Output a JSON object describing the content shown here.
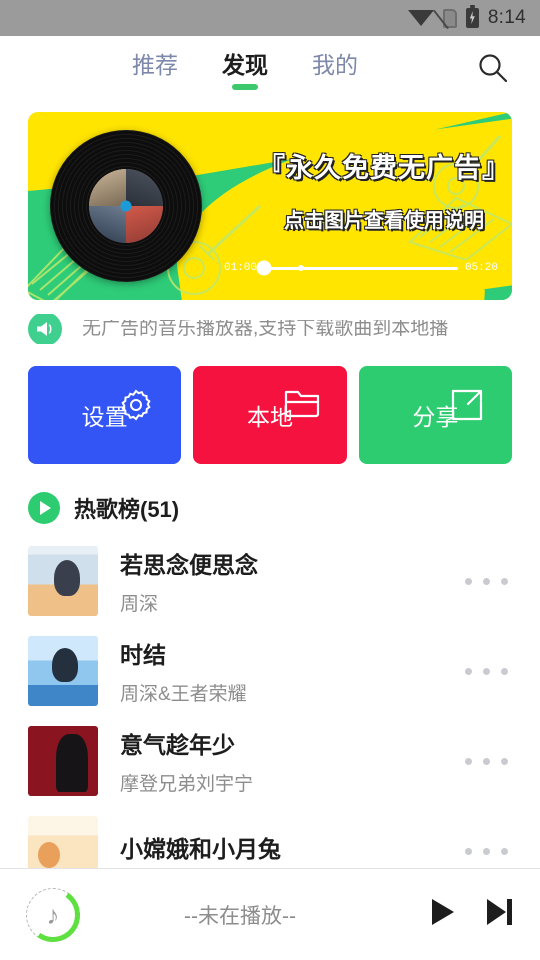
{
  "statusbar": {
    "time": "8:14",
    "icons": [
      "wifi-icon",
      "sim-card-off-icon",
      "battery-charging-icon"
    ]
  },
  "topbar": {
    "tabs": [
      {
        "label": "推荐",
        "active": false
      },
      {
        "label": "发现",
        "active": true
      },
      {
        "label": "我的",
        "active": false
      }
    ],
    "search_icon": "search-icon"
  },
  "banner": {
    "title": "『永久免费无广告』",
    "subtitle": "点击图片查看使用说明",
    "current_time": "01:00",
    "total_time": "05:20",
    "colors": {
      "yellow": "#ffe500",
      "green": "#2ecc78",
      "outline": "#bfe86b"
    }
  },
  "notice": {
    "icon": "megaphone-icon",
    "text": "无广告的音乐播放器,支持下载歌曲到本地播"
  },
  "actions": [
    {
      "label": "设置",
      "icon": "gear-icon",
      "color": "#3355f5"
    },
    {
      "label": "本地",
      "icon": "folder-icon",
      "color": "#f5123e"
    },
    {
      "label": "分享",
      "icon": "share-icon",
      "color": "#2ecc71"
    }
  ],
  "section": {
    "icon": "play-circle-icon",
    "title": "热歌榜(51)"
  },
  "songs": [
    {
      "title": "若思念便思念",
      "artist": "周深",
      "cover": "cv1",
      "menu": "more-icon"
    },
    {
      "title": "时结",
      "artist": "周深&王者荣耀",
      "cover": "cv2",
      "menu": "more-icon"
    },
    {
      "title": "意气趁年少",
      "artist": "摩登兄弟刘宇宁",
      "cover": "cv3",
      "menu": "more-icon"
    },
    {
      "title": "小嫦娥和小月兔",
      "artist": "",
      "cover": "cv4",
      "menu": "more-icon"
    }
  ],
  "player": {
    "art_icon": "music-note-icon",
    "title": "--未在播放--",
    "play_icon": "play-icon",
    "next_icon": "next-track-icon"
  }
}
